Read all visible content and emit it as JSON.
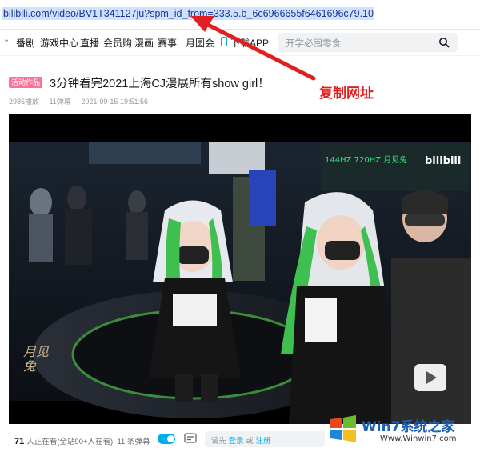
{
  "browser": {
    "url": "bilibili.com/video/BV1T341127ju?spm_id_from=333.5.b_6c6966655f6461696c79.10"
  },
  "nav": {
    "items": [
      {
        "label": "番剧"
      },
      {
        "label": "游戏中心"
      },
      {
        "label": "直播"
      },
      {
        "label": "会员购"
      },
      {
        "label": "漫画"
      },
      {
        "label": "赛事"
      },
      {
        "label": "月圆会"
      },
      {
        "label": "下载APP"
      }
    ],
    "search_placeholder": "开学必囤零食"
  },
  "video": {
    "tag": "活动作品",
    "title": "3分钟看完2021上海CJ漫展所有show girl！",
    "views": "2986播放",
    "danmaku": "11弹幕",
    "date": "2021-09-15 19:51:56"
  },
  "player": {
    "seal_text": "月见兔",
    "sign_text": "144HZ  720HZ  月见兔",
    "brand_text": "bilibili"
  },
  "bottom_bar": {
    "online_count": "71",
    "online_text": "人正在看(全站90+人在看), 11 条弹幕",
    "danmaku_prompt": "请先",
    "login": "登录",
    "or": "或",
    "register": "注册"
  },
  "annotation": {
    "text": "复制网址",
    "color": "#e02020"
  },
  "watermark": {
    "brand": "Win7系统之家",
    "url": "Www.Winwin7.com"
  },
  "colors": {
    "accent": "#00aeec",
    "tag": "#fb7299"
  }
}
